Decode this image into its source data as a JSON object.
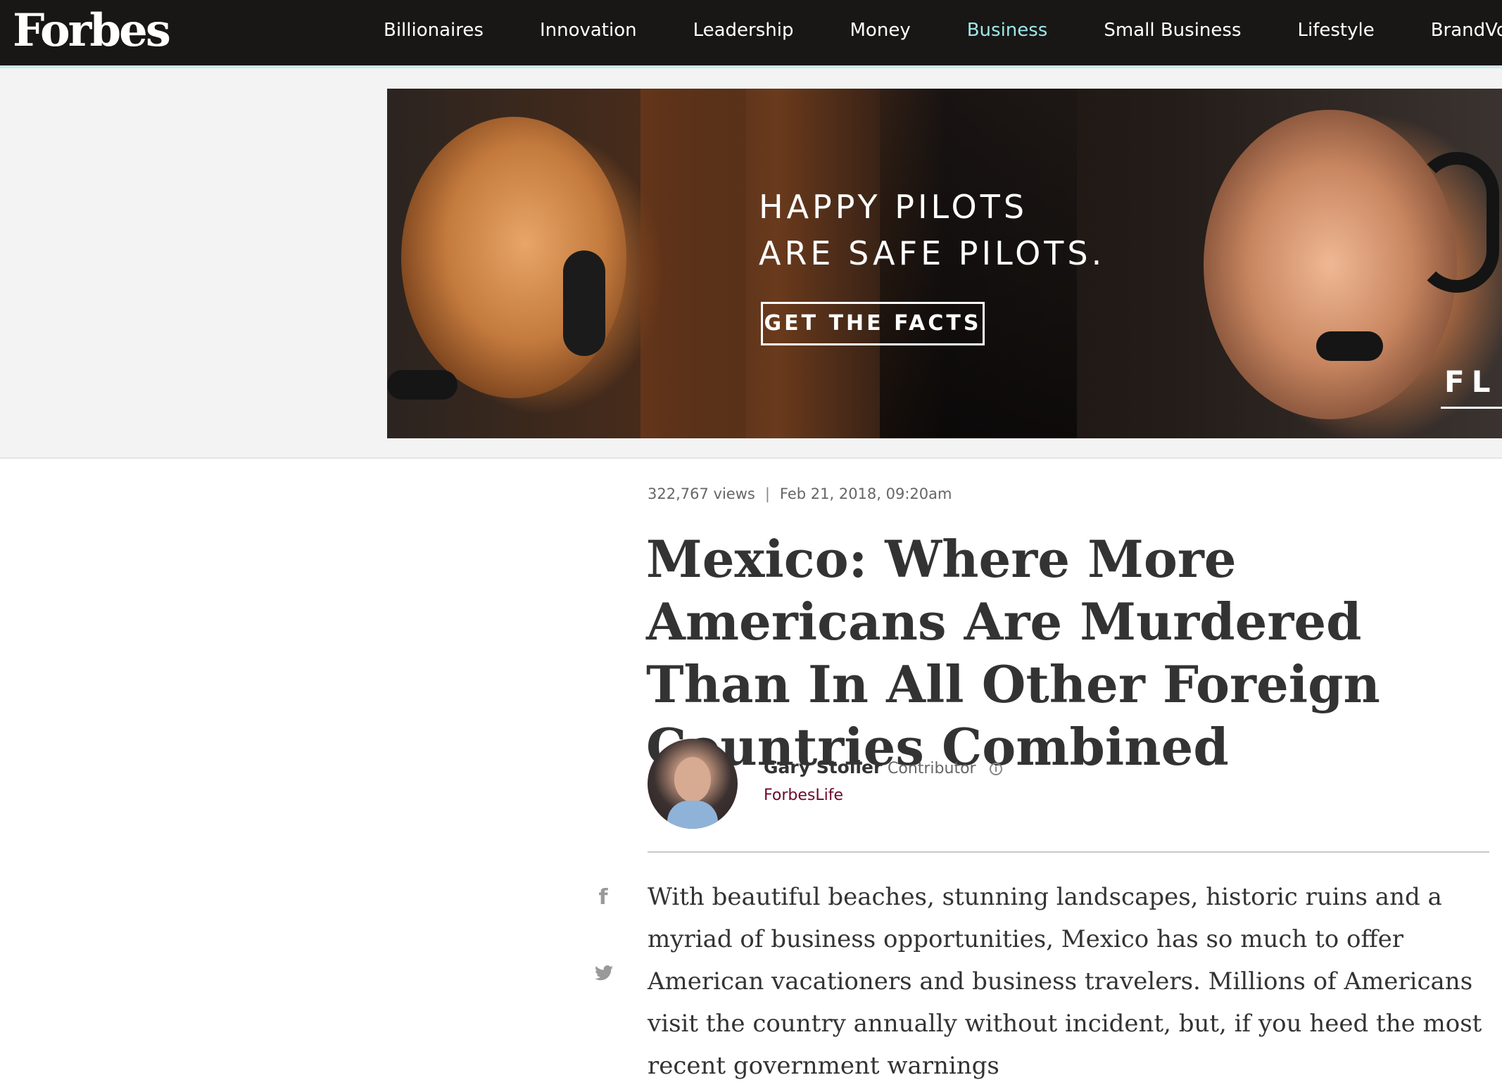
{
  "nav": {
    "logo": "Forbes",
    "items": [
      {
        "label": "Billionaires",
        "active": false
      },
      {
        "label": "Innovation",
        "active": false
      },
      {
        "label": "Leadership",
        "active": false
      },
      {
        "label": "Money",
        "active": false
      },
      {
        "label": "Business",
        "active": true
      },
      {
        "label": "Small Business",
        "active": false
      },
      {
        "label": "Lifestyle",
        "active": false
      },
      {
        "label": "BrandVoic",
        "active": false
      }
    ],
    "accent_color": "#9ee6e6",
    "bar_color": "#181716"
  },
  "ad": {
    "headline": "HAPPY PILOTS\nARE SAFE PILOTS.",
    "cta": "GET THE FACTS",
    "brand_partial": "FL"
  },
  "article": {
    "views": "322,767 views",
    "separator": "|",
    "date": "Feb 21, 2018, 09:20am",
    "headline": "Mexico: Where More Americans Are Murdered Than In All Other Foreign Countries Combined",
    "author": {
      "name": "Gary Stoller",
      "role": "Contributor",
      "section": "ForbesLife"
    },
    "body_first_paragraph": "With beautiful beaches, stunning landscapes, historic ruins and a myriad of business opportunities, Mexico has so much to offer American vacationers and business travelers. Millions of Americans visit the country annually without incident, but, if you heed the most recent government warnings"
  },
  "icons": {
    "info": "info-circle-icon",
    "facebook": "facebook-icon",
    "twitter": "twitter-icon"
  }
}
